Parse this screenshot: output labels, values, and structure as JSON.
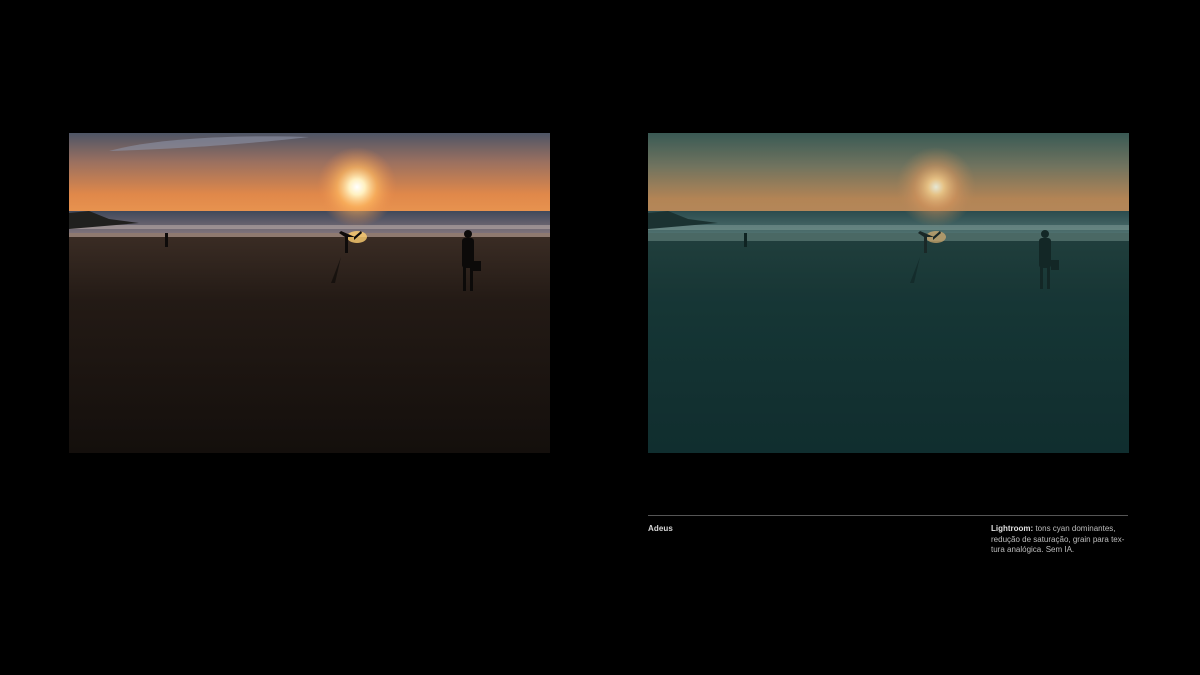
{
  "photos": {
    "original": {
      "alt_name": "beach-sunset-original"
    },
    "edited": {
      "alt_name": "beach-sunset-lightroom-edit"
    }
  },
  "caption": {
    "title": "Adeus",
    "note_label": "Lightroom:",
    "note_text": " tons cyan dominantes, redução de saturação, grain para tex-tura analógica. Sem IA."
  },
  "colors": {
    "background": "#000000",
    "divider": "#555555",
    "original_sky_top": "#5a6070",
    "original_sky_glow": "#e08a4a",
    "edited_sky_top": "#3f5a55",
    "edited_sky_glow": "#c98b55",
    "edited_sand": "#0e2a2a"
  }
}
